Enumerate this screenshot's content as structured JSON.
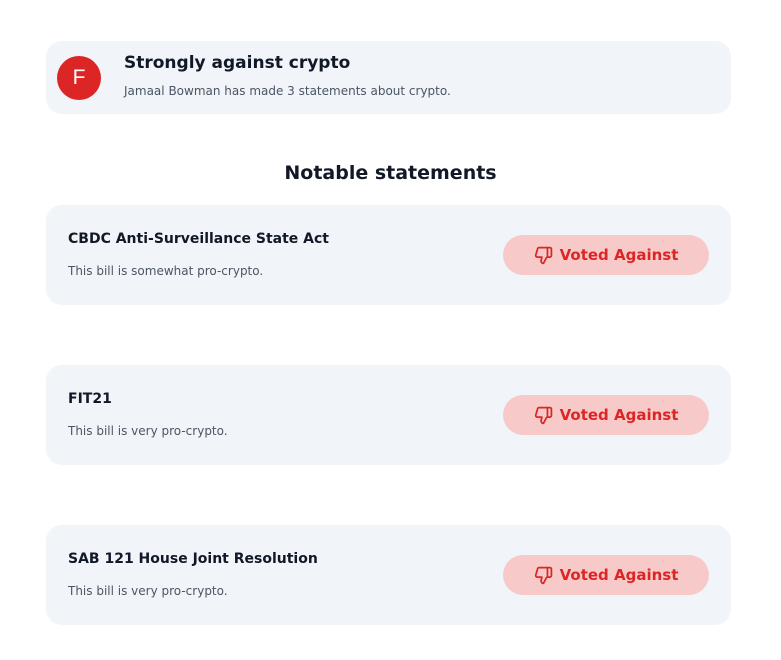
{
  "grade": {
    "letter": "F",
    "title": "Strongly against crypto",
    "subtitle": "Jamaal Bowman has made 3 statements about crypto.",
    "badge_color": "#dc2626"
  },
  "section": {
    "title": "Notable statements"
  },
  "statements": [
    {
      "title": "CBDC Anti-Surveillance State Act",
      "description": "This bill is somewhat pro-crypto.",
      "vote": "Voted Against",
      "icon": "thumbs-down-icon"
    },
    {
      "title": "FIT21",
      "description": "This bill is very pro-crypto.",
      "vote": "Voted Against",
      "icon": "thumbs-down-icon"
    },
    {
      "title": "SAB 121 House Joint Resolution",
      "description": "This bill is very pro-crypto.",
      "vote": "Voted Against",
      "icon": "thumbs-down-icon"
    }
  ],
  "colors": {
    "card_background": "#f1f4f8",
    "vote_pill_background": "#f8c9c9",
    "vote_text": "#dc2626"
  }
}
